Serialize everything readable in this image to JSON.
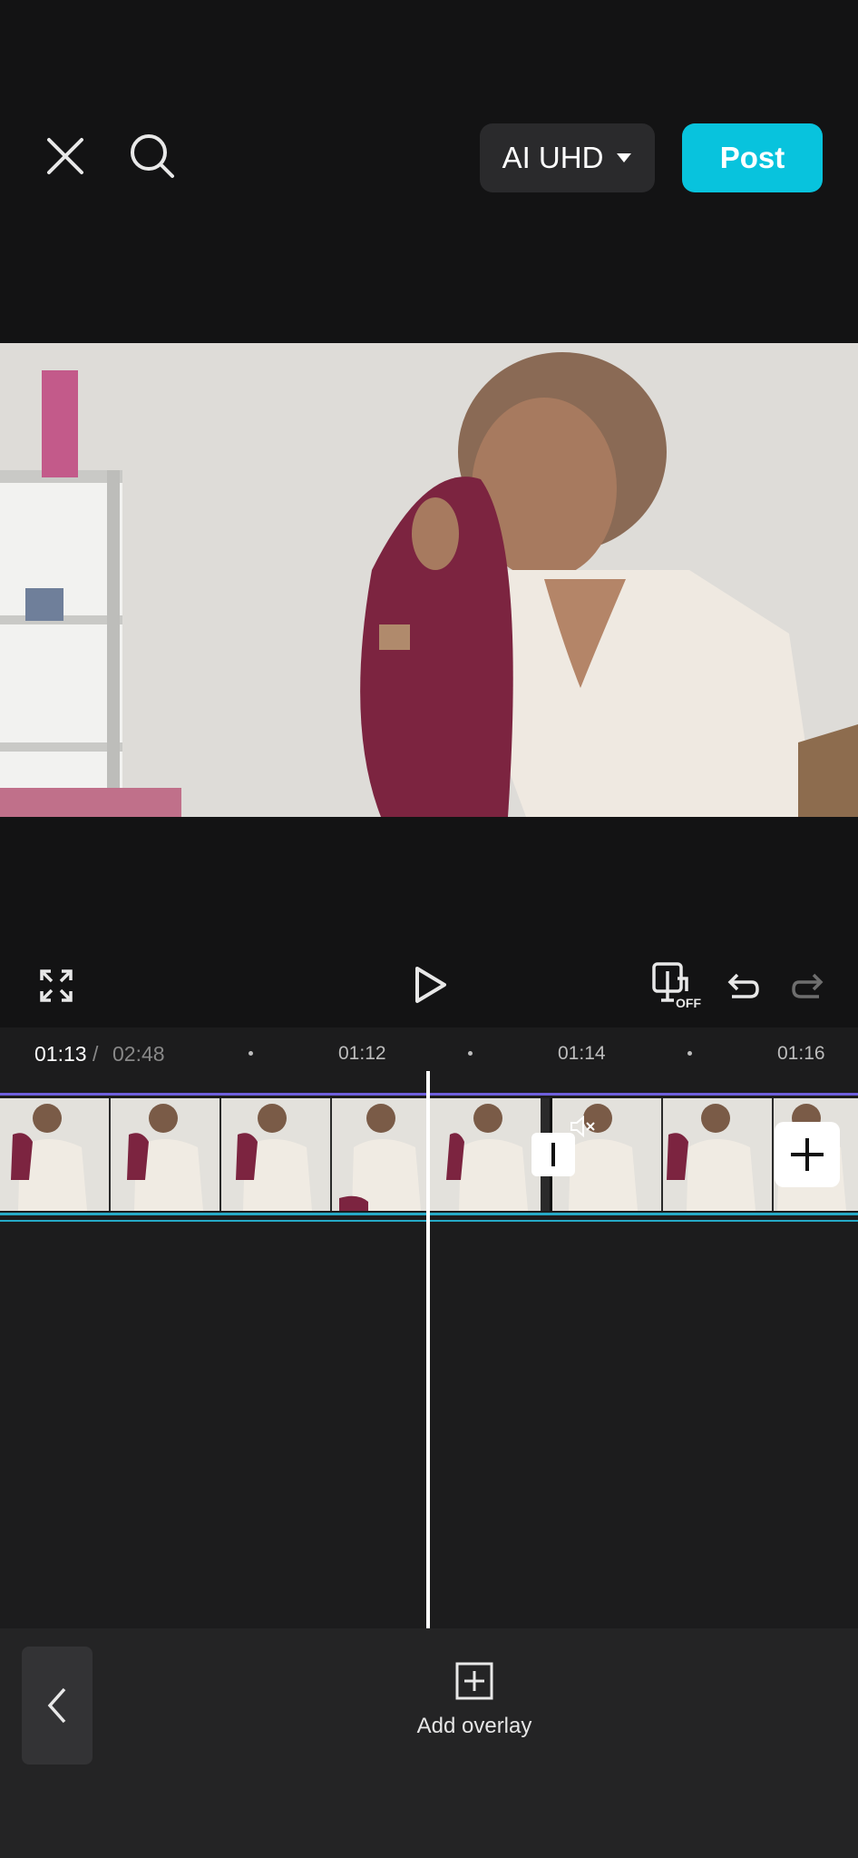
{
  "header": {
    "quality_label": "AI UHD",
    "post_label": "Post"
  },
  "timeline": {
    "current_time": "01:13",
    "separator": "/",
    "total_time": "02:48",
    "ticks": [
      "01:12",
      "01:14",
      "01:16"
    ]
  },
  "toolbar": {
    "add_overlay_label": "Add overlay"
  },
  "keyframe_badge": "OFF",
  "colors": {
    "accent": "#08c3dd",
    "track_top": "#6e5fdc",
    "track_bottom": "#26a9c6"
  }
}
